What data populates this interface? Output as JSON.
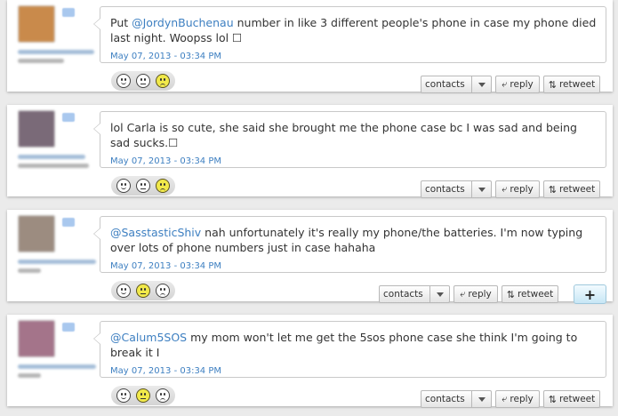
{
  "tweets": [
    {
      "pre": "Put ",
      "mention": "@JordynBuchenau",
      "text": " number in like 3 different people's phone in case my phone died last night. Woopss lol ☐",
      "timestamp": "May 07, 2013 - 03:34 PM",
      "avatar_color": "#c98a4b",
      "selected_emotion": "negative"
    },
    {
      "pre": "",
      "mention": "",
      "text": "lol Carla is so cute, she said she brought me the phone case bc I was sad and being sad sucks.☐",
      "timestamp": "May 07, 2013 - 03:34 PM",
      "avatar_color": "#7a6a78",
      "selected_emotion": "negative"
    },
    {
      "pre": "",
      "mention": "@SasstasticShiv",
      "text": " nah unfortunately it's really my phone/the batteries. I'm now typing over lots of phone numbers just in case hahaha",
      "timestamp": "May 07, 2013 - 03:34 PM",
      "avatar_color": "#9c8c80",
      "selected_emotion": "neutral"
    },
    {
      "pre": "",
      "mention": "@Calum5SOS",
      "text": " my mom won't let me get the 5sos phone case she think I'm going to break it I",
      "timestamp": "May 07, 2013 - 03:34 PM",
      "avatar_color": "#a4748a",
      "selected_emotion": "neutral"
    }
  ],
  "actions": {
    "contacts": "contacts",
    "reply": "reply",
    "retweet": "retweet",
    "add": "+"
  },
  "icons": {
    "reply": "reply-arrow-icon",
    "retweet": "retweet-icon",
    "contacts_dropdown": "chevron-down-icon"
  },
  "colors": {
    "mention": "#3d7fc1",
    "timestamp": "#3d7fc1",
    "highlighted_face": "#f1e94a"
  }
}
